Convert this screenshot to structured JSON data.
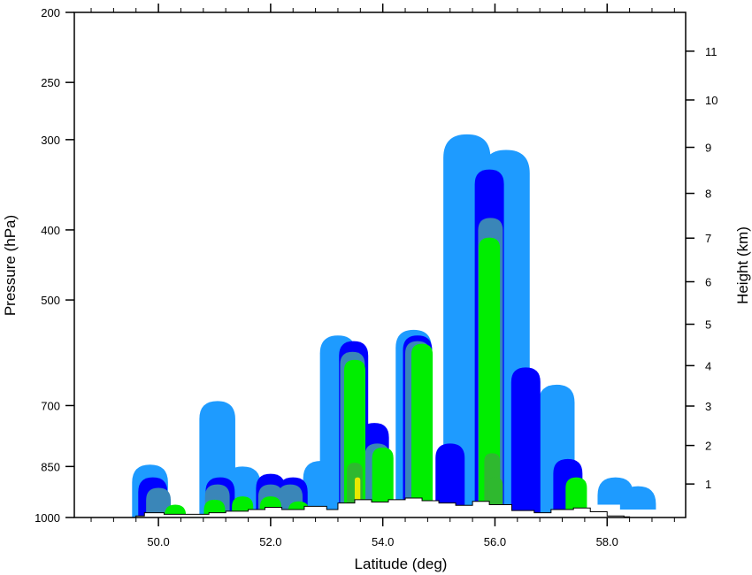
{
  "chart_data": {
    "type": "heatmap",
    "title": "",
    "xlabel": "Latitude (deg)",
    "ylabel_left": "Pressure (hPa)",
    "ylabel_right": "Height (km)",
    "xlim": [
      48.5,
      59.4
    ],
    "x_ticks": [
      50.0,
      52.0,
      54.0,
      56.0,
      58.0
    ],
    "x_tick_labels": [
      "50.0",
      "52.0",
      "54.0",
      "56.0",
      "58.0"
    ],
    "y_scale": "log",
    "ylim_pressure": [
      1000,
      200
    ],
    "y_ticks_pressure": [
      1000,
      850,
      700,
      500,
      400,
      300,
      250,
      200
    ],
    "y_tick_labels_pressure": [
      "1000",
      "850",
      "700",
      "500",
      "400",
      "300",
      "250",
      "200"
    ],
    "y_ticks_height": [
      1,
      2,
      3,
      4,
      5,
      6,
      7,
      8,
      9,
      10,
      11
    ],
    "y_tick_labels_height": [
      "1",
      "2",
      "3",
      "4",
      "5",
      "6",
      "7",
      "8",
      "9",
      "10",
      "11"
    ],
    "contour_colors": [
      "#1e9bff",
      "#0000ff",
      "#3a86b8",
      "#3aab8a",
      "#00ee00",
      "#2fb82f",
      "#e8e800"
    ],
    "contour_regions": [
      {
        "level": 0,
        "x": [
          49.85,
          51.05,
          51.5,
          52.9,
          53.2,
          54.55,
          55.55,
          55.5,
          56.2,
          57.1,
          58.15,
          58.55
        ],
        "p_top": [
          845,
          690,
          850,
          835,
          560,
          550,
          560,
          295,
          310,
          655,
          880,
          905
        ],
        "p_bot": [
          1000,
          1000,
          1000,
          1000,
          1000,
          1000,
          1000,
          1000,
          1000,
          1000,
          960,
          975
        ]
      },
      {
        "level": 1,
        "x": [
          49.9,
          51.1,
          52.0,
          52.4,
          53.48,
          53.85,
          54.62,
          55.2,
          55.9,
          56.55,
          57.3
        ],
        "p_top": [
          880,
          880,
          870,
          880,
          570,
          740,
          560,
          790,
          330,
          620,
          830
        ],
        "p_bot": [
          1000,
          1000,
          1000,
          1000,
          1000,
          1000,
          1000,
          1000,
          1000,
          1000,
          1000
        ]
      },
      {
        "level": 2,
        "x": [
          50.0,
          51.05,
          52.0,
          52.35,
          53.46,
          53.9,
          54.62,
          55.92
        ],
        "p_top": [
          910,
          900,
          900,
          900,
          590,
          790,
          570,
          385
        ],
        "p_bot": [
          1000,
          1000,
          1000,
          1000,
          1000,
          1000,
          1000,
          1000
        ]
      },
      {
        "level": 4,
        "x": [
          50.3,
          51.0,
          51.5,
          52.0,
          52.5,
          53.5,
          54.0,
          54.7,
          55.9,
          57.45
        ],
        "p_top": [
          960,
          945,
          935,
          935,
          950,
          605,
          800,
          575,
          410,
          880
        ],
        "p_bot": [
          990,
          990,
          990,
          985,
          985,
          980,
          978,
          972,
          985,
          988
        ]
      },
      {
        "level": 5,
        "x": [
          53.5,
          55.95,
          56.0
        ],
        "p_top": [
          840,
          815,
          880
        ],
        "p_bot": [
          980,
          985,
          985
        ]
      },
      {
        "level": 6,
        "x": [
          53.55
        ],
        "p_top": [
          880
        ],
        "p_bot": [
          975
        ]
      }
    ],
    "grid": false,
    "legend": "none"
  }
}
